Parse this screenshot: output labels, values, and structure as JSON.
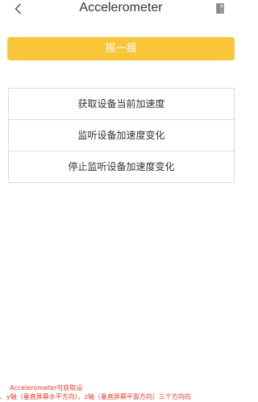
{
  "nav": {
    "title": "Accelerometer",
    "back_icon": "chevron-left-icon",
    "doc_icon": "document-icon"
  },
  "shake_button": {
    "label": "摇一摇"
  },
  "actions": [
    {
      "label": "获取设备当前加速度"
    },
    {
      "label": "监听设备加速度变化"
    },
    {
      "label": "停止监听设备加速度变化"
    }
  ],
  "footer_note": {
    "line1": "Accelerometer可获取设",
    "line2": "、y轴（垂直屏幕水平方向）、z轴（垂直屏幕平面方向）三个方向的"
  },
  "colors": {
    "accent": "#f9c539",
    "note_text": "#e63b2e",
    "border": "#dcdcdc"
  }
}
